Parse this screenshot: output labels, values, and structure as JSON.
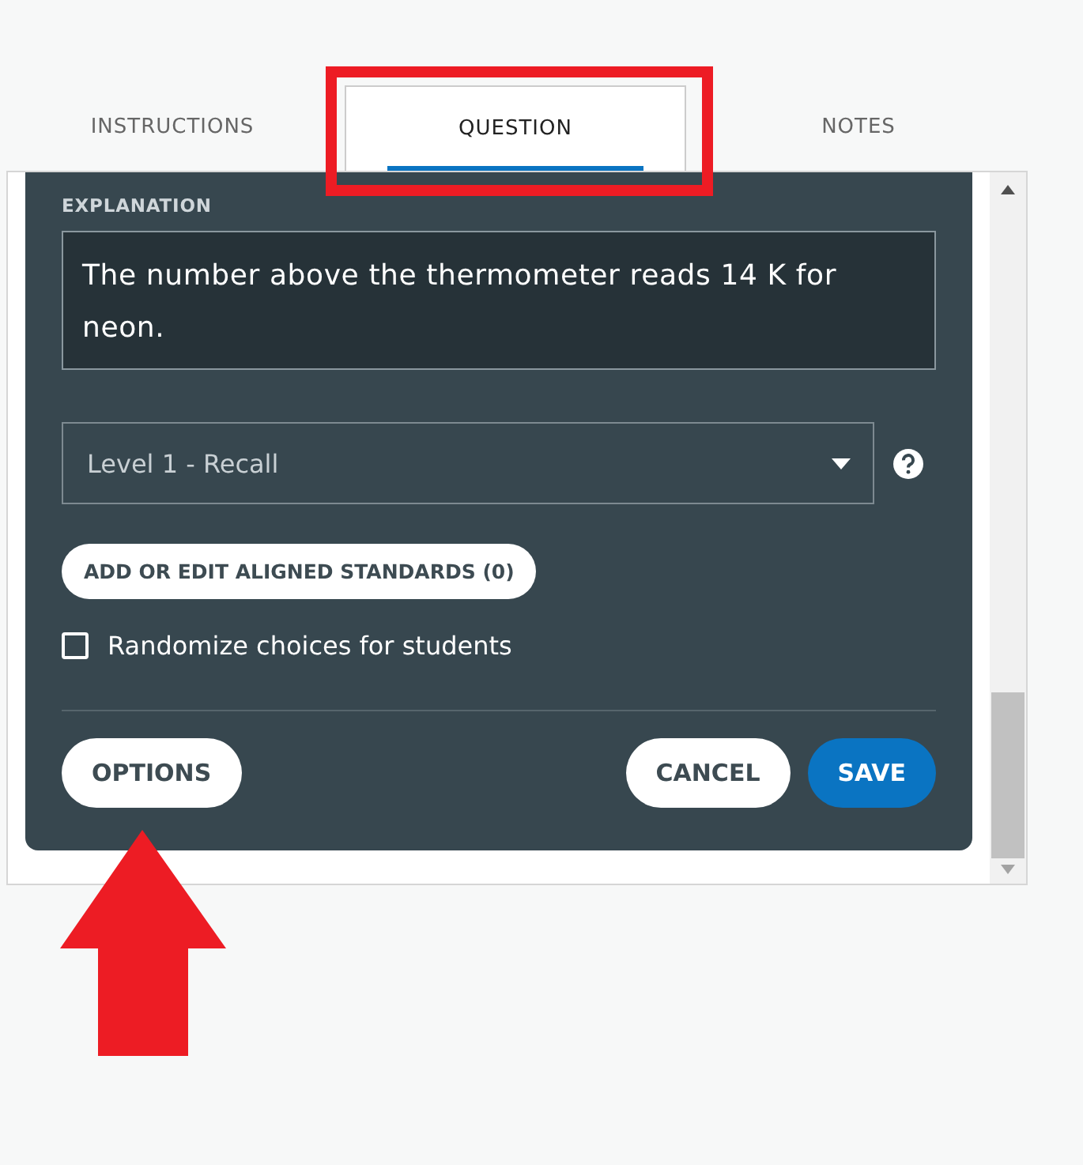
{
  "tabs": [
    {
      "label": "INSTRUCTIONS",
      "selected": false
    },
    {
      "label": "QUESTION",
      "selected": true
    },
    {
      "label": "NOTES",
      "selected": false
    }
  ],
  "explanation": {
    "label": "EXPLANATION",
    "text": "The number above the thermometer reads 14 K for neon."
  },
  "level_select": {
    "value": "Level 1 - Recall"
  },
  "standards_button": "ADD OR EDIT ALIGNED STANDARDS (0)",
  "randomize": {
    "label": "Randomize choices for students",
    "checked": false
  },
  "buttons": [
    {
      "label": "OPTIONS",
      "kind": "secondary"
    },
    {
      "label": "CANCEL",
      "kind": "secondary"
    },
    {
      "label": "SAVE",
      "kind": "primary"
    }
  ]
}
